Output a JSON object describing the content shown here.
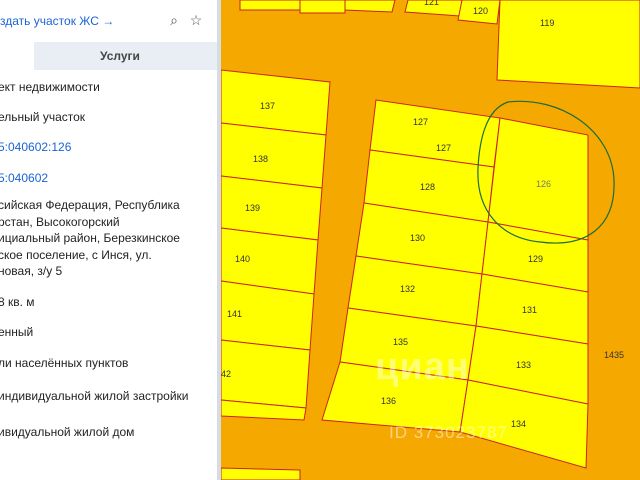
{
  "header": {
    "action_link": "здать участок ЖС →"
  },
  "tabs": {
    "second_label": "Услуги"
  },
  "details": {
    "type": "ект недвижимости",
    "kind": "ельный участок",
    "cad_number": "5:040602:126",
    "quarter": "5:040602",
    "address_lines": [
      "сийская Федерация, Республика",
      "рстан, Высокогорский",
      "ициальный район, Березкинское",
      "ское поселение, с Инся, ул.",
      "новая, з/у 5"
    ],
    "area": "8 кв. м",
    "status": "енный",
    "category": "ли населённых пунктов",
    "use1": "индивидуальной жилой застройки",
    "use2": "ивидуальной жилой дом"
  },
  "map": {
    "parcel_labels": [
      "121",
      "120",
      "119",
      "137",
      "127",
      "127",
      "126",
      "138",
      "128",
      "139",
      "130",
      "140",
      "129",
      "132",
      "131",
      "141",
      "135",
      "42",
      "133",
      "1435",
      "136",
      "134"
    ],
    "watermark": "циан",
    "watermark_id": "ID 373023787"
  },
  "colors": {
    "parcel_fill": "#ffff00",
    "road": "#f5a800",
    "border": "#cc2222",
    "link": "#1a64d6"
  }
}
